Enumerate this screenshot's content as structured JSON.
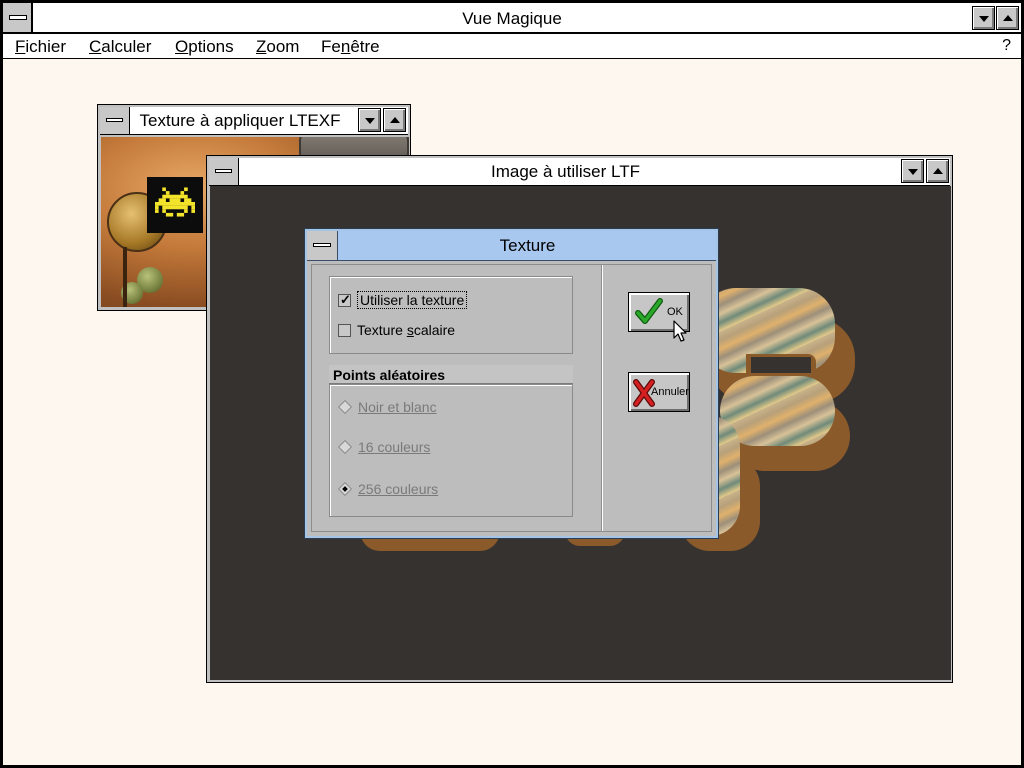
{
  "app": {
    "title": "Vue Magique",
    "menu": {
      "fichier": {
        "pre": "",
        "key": "F",
        "post": "ichier"
      },
      "calculer": {
        "pre": "",
        "key": "C",
        "post": "alculer"
      },
      "options": {
        "pre": "",
        "key": "O",
        "post": "ptions"
      },
      "zoom": {
        "pre": "",
        "key": "Z",
        "post": "oom"
      },
      "fenetre": {
        "pre": "Fe",
        "key": "n",
        "post": "être"
      }
    },
    "help": "?"
  },
  "texture_window": {
    "title": "Texture à appliquer LTEXF"
  },
  "image_window": {
    "title": "Image à utiliser LTF"
  },
  "dialog": {
    "title": "Texture",
    "options": {
      "use_texture": {
        "label": "Utiliser la texture",
        "checked": true
      },
      "scalar_texture": {
        "label_pre": "Texture ",
        "label_key": "s",
        "label_post": "calaire",
        "checked": false
      }
    },
    "random_points": {
      "title": "Points aléatoires",
      "items": [
        {
          "label": "Noir et blanc",
          "selected": false,
          "enabled": false
        },
        {
          "label": "16 couleurs",
          "selected": false,
          "enabled": false
        },
        {
          "label": "256 couleurs",
          "selected": true,
          "enabled": false
        }
      ]
    },
    "buttons": {
      "ok": "OK",
      "cancel": "Annuler"
    }
  },
  "colors": {
    "desktop": "#fdf7ef",
    "image_background": "#363230",
    "dialog_title": "#a8c8ef",
    "ok_check": "#1a8a1a",
    "cancel_x": "#c01818"
  },
  "icons": {
    "ok": "green-checkmark-icon",
    "cancel": "red-x-icon"
  }
}
